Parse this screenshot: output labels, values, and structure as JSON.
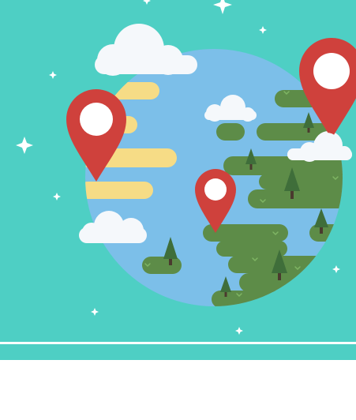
{
  "colors": {
    "background_teal": "#4ecfc4",
    "globe_blue": "#7cbfe9",
    "land_green": "#5d8c48",
    "desert_yellow": "#f6dc86",
    "cloud_white": "#f5f8fb",
    "pin_red": "#cf413c",
    "pin_center": "#ffffff",
    "tree_green": "#3f6e3a",
    "tree_trunk": "#4a3a2e",
    "sparkle_white": "#ffffff",
    "footer_white": "#ffffff"
  },
  "icons": {
    "pins": [
      "map-pin-icon",
      "map-pin-icon",
      "map-pin-icon"
    ],
    "trees": [
      "pine-tree-icon"
    ],
    "clouds": [
      "cloud-icon"
    ],
    "sparkles": [
      "sparkle-icon"
    ]
  }
}
